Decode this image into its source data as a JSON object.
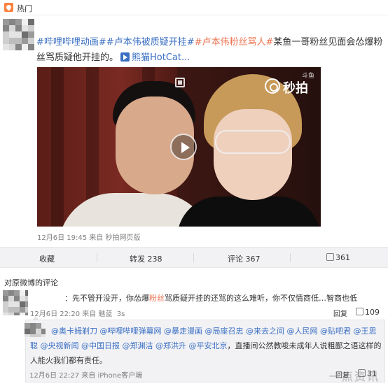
{
  "header": {
    "label": "热门"
  },
  "post": {
    "tags": [
      "#哔哩哔哩动画#",
      "#卢本伟被质疑开挂#",
      "#卢本伟粉丝骂人#"
    ],
    "text": "某鱼一哥粉丝见面会怂爆粉丝骂质疑他开挂的。",
    "link_label": "熊猫HotCat...",
    "meta": "12月6日 19:45 来自 秒拍网页版"
  },
  "video": {
    "watermark_site": "斗鱼",
    "watermark_text": "秒拍"
  },
  "actions": {
    "collect": "收藏",
    "repost": "转发 238",
    "comment": "评论 367",
    "like": "361"
  },
  "comments": {
    "header": "对原微博的评论",
    "items": [
      {
        "text_prefix": "：先不管开没开，你怂爆",
        "text_highlight": "粉丝",
        "text_suffix": "骂质疑开挂的还骂的这么难听，你不仅情商低…智商也低",
        "time": "12月6日 22:20 来自",
        "name": "魅蓝",
        "level": "3s",
        "reply_label": "回复",
        "likes": "109"
      }
    ],
    "reply": {
      "mentions": "@奥卡姆剃刀 @哔哩哔哩弹幕网 @暴走漫画 @局座召忠 @来去之间 @人民网 @贴吧君 @王思聪 @央视新闻 @中国日报 @郑渊洁 @郑洪升 @平安北京",
      "text": "，直播间公然教唆未成年人说粗鄙之语这样的人能火我们都有责任。",
      "time": "12月6日 22:27 来自 iPhone客户端",
      "reply_label": "回复",
      "likes": "31"
    }
  },
  "watermark": "一点资讯"
}
